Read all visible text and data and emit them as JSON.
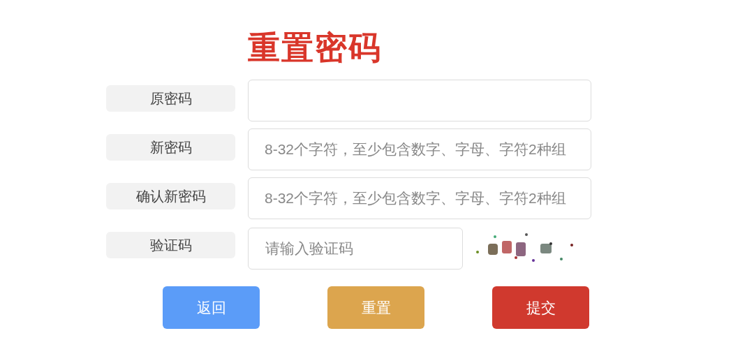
{
  "title": "重置密码",
  "fields": [
    {
      "label": "原密码",
      "kind": "wide"
    },
    {
      "label": "新密码",
      "kind": "wide",
      "placeholder": "8-32个字符，至少包含数字、字母、字符2种组"
    },
    {
      "label": "确认新密码",
      "kind": "wide",
      "placeholder": "8-32个字符，至少包含数字、字母、字符2种组"
    },
    {
      "label": "验证码",
      "kind": "captcha",
      "placeholder": "请输入验证码"
    }
  ],
  "buttons": [
    {
      "label": "返回",
      "color": "#5b9cf8"
    },
    {
      "label": "重置",
      "color": "#dca54e"
    },
    {
      "label": "提交",
      "color": "#d0392e"
    }
  ]
}
